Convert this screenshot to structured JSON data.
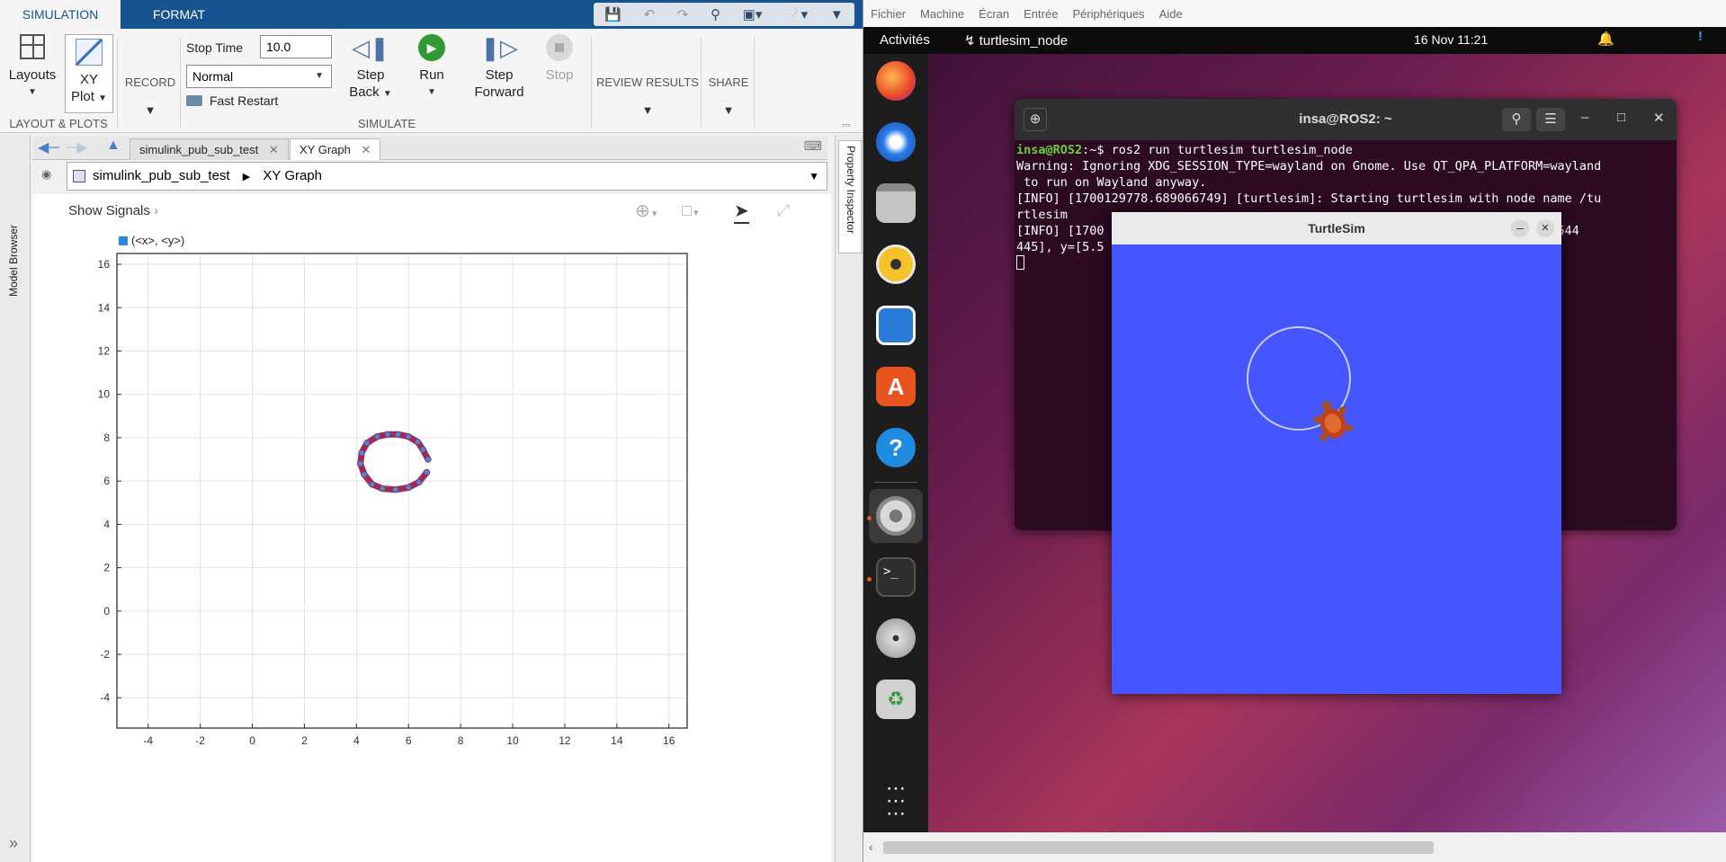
{
  "matlab": {
    "tabs": {
      "simulation": "SIMULATION",
      "format": "FORMAT"
    },
    "ribbon": {
      "layouts": "Layouts",
      "xy_plot_line1": "XY",
      "xy_plot_line2": "Plot",
      "record": "RECORD",
      "stop_time_label": "Stop Time",
      "stop_time_value": "10.0",
      "mode_value": "Normal",
      "fast_restart": "Fast Restart",
      "step_back_line1": "Step",
      "step_back_line2": "Back",
      "run": "Run",
      "step_forward_line1": "Step",
      "step_forward_line2": "Forward",
      "stop": "Stop",
      "review_results": "REVIEW RESULTS",
      "share": "SHARE",
      "section_layout": "LAYOUT & PLOTS",
      "section_simulate": "SIMULATE"
    },
    "editor_tabs": [
      "simulink_pub_sub_test",
      "XY Graph"
    ],
    "breadcrumb": {
      "model": "simulink_pub_sub_test",
      "block": "XY Graph"
    },
    "side_labels": {
      "left": "Model Browser",
      "right": "Property Inspector"
    },
    "show_signals": "Show Signals",
    "expand_glyph": "»",
    "legend": "(<x>, <y>)"
  },
  "chart_data": {
    "type": "scatter",
    "legend": [
      "(<x>, <y>)"
    ],
    "xlim": [
      -5.2,
      16.7
    ],
    "ylim": [
      -5.4,
      16.5
    ],
    "xticks": [
      -4,
      -2,
      0,
      2,
      4,
      6,
      8,
      10,
      12,
      14,
      16
    ],
    "yticks": [
      -4,
      -2,
      0,
      2,
      4,
      6,
      8,
      10,
      12,
      14,
      16
    ],
    "grid": true,
    "series": [
      {
        "name": "(<x>, <y>)",
        "color": "#a0285a",
        "marker_color": "#3f8fd8",
        "x": [
          6.7,
          6.4,
          6.0,
          5.5,
          5.0,
          4.6,
          4.3,
          4.15,
          4.2,
          4.4,
          4.8,
          5.2,
          5.6,
          6.0,
          6.35,
          6.55,
          6.75
        ],
        "y": [
          6.4,
          5.95,
          5.7,
          5.6,
          5.65,
          5.85,
          6.3,
          6.8,
          7.3,
          7.75,
          8.05,
          8.15,
          8.15,
          8.05,
          7.8,
          7.45,
          7.0
        ]
      }
    ]
  },
  "vm": {
    "menu": [
      "Fichier",
      "Machine",
      "Écran",
      "Entrée",
      "Périphériques",
      "Aide"
    ],
    "topbar": {
      "activities": "Activités",
      "app": "turtlesim_node",
      "datetime": "16 Nov  11:21"
    },
    "terminal": {
      "title": "insa@ROS2: ~",
      "prompt_user": "insa@ROS2",
      "prompt_rest": ":~$ ros2 run turtlesim turtlesim_node",
      "lines": [
        "Warning: Ignoring XDG_SESSION_TYPE=wayland on Gnome. Use QT_QPA_PLATFORM=wayland",
        " to run on Wayland anyway.",
        "[INFO] [1700129778.689066749] [turtlesim]: Starting turtlesim with node name /tu",
        "rtlesim",
        "[INFO] [1700                                                    ] at x=[5.544",
        "445], y=[5.5"
      ]
    },
    "turtlesim": {
      "title": "TurtleSim",
      "background": "#4556ff"
    }
  }
}
